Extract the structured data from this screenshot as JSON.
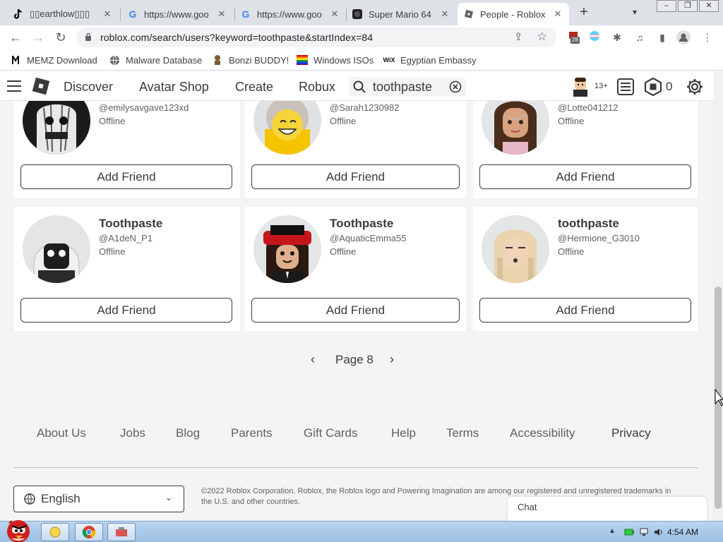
{
  "browser": {
    "tabs": [
      {
        "title": "▯▯earthlow▯▯▯",
        "icon": "tiktok-icon"
      },
      {
        "title": "https://www.goo",
        "icon": "google-icon"
      },
      {
        "title": "https://www.goo",
        "icon": "google-icon"
      },
      {
        "title": "Super Mario 64",
        "icon": "mario-icon"
      },
      {
        "title": "People - Roblox",
        "icon": "roblox-icon",
        "active": true
      }
    ],
    "new_tab_label": "+",
    "url": "roblox.com/search/users?keyword=toothpaste&startIndex=84",
    "extension_badge": "28",
    "bookmarks": [
      {
        "label": "MEMZ Download"
      },
      {
        "label": "Malware Database"
      },
      {
        "label": "Bonzi BUDDY!"
      },
      {
        "label": "Windows ISOs"
      },
      {
        "label": "Egyptian Embassy"
      }
    ]
  },
  "header": {
    "nav": [
      "Discover",
      "Avatar Shop",
      "Create",
      "Robux"
    ],
    "search_value": "toothpaste",
    "age_badge": "13+",
    "robux_count": "0"
  },
  "results": [
    {
      "display": "",
      "username": "@emilysavgave123xd",
      "status": "Offline",
      "button": "Add Friend"
    },
    {
      "display": "",
      "username": "@Sarah1230982",
      "status": "Offline",
      "button": "Add Friend"
    },
    {
      "display": "",
      "username": "@Lotte041212",
      "status": "Offline",
      "button": "Add Friend"
    },
    {
      "display": "Toothpaste",
      "username": "@A1deN_P1",
      "status": "Offline",
      "button": "Add Friend"
    },
    {
      "display": "Toothpaste",
      "username": "@AquaticEmma55",
      "status": "Offline",
      "button": "Add Friend"
    },
    {
      "display": "toothpaste",
      "username": "@Hermione_G3010",
      "status": "Offline",
      "button": "Add Friend"
    }
  ],
  "pager": {
    "label": "Page 8"
  },
  "footer": {
    "links": [
      "About Us",
      "Jobs",
      "Blog",
      "Parents",
      "Gift Cards",
      "Help",
      "Terms",
      "Accessibility",
      "Privacy"
    ],
    "language": "English",
    "copyright": "©2022 Roblox Corporation. Roblox, the Roblox logo and Powering Imagination are among our registered and unregistered trademarks in the U.S. and other countries."
  },
  "chat": {
    "label": "Chat"
  },
  "taskbar": {
    "time": "4:54 AM"
  },
  "colors": {
    "accent": "#393b3d",
    "page_bg": "#f2f4f5",
    "card_bg": "#ffffff",
    "taskbar": "#b9d4ef"
  }
}
